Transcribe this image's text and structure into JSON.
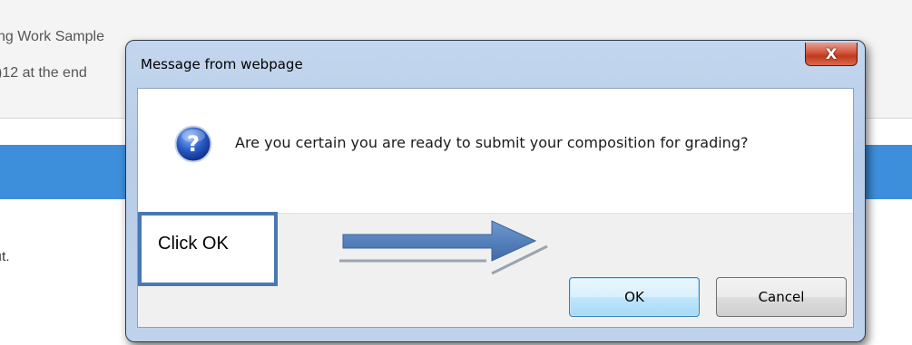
{
  "background": {
    "line1": "ng Work Sample",
    "line2": ")12 at the end",
    "line3": "ıt."
  },
  "dialog": {
    "title": "Message from webpage",
    "close_label": "X",
    "icon": "question-icon",
    "icon_glyph": "?",
    "message": "Are you certain you are ready to submit your composition for grading?",
    "buttons": {
      "ok_label": "OK",
      "cancel_label": "Cancel"
    }
  },
  "annotation": {
    "label": "Click OK",
    "arrow": "arrow-right-icon"
  },
  "colors": {
    "page_band": "#3d8fdc",
    "annotation_border": "#4a77b4",
    "arrow": "#4a77b4",
    "close_button": "#c13a1d"
  }
}
